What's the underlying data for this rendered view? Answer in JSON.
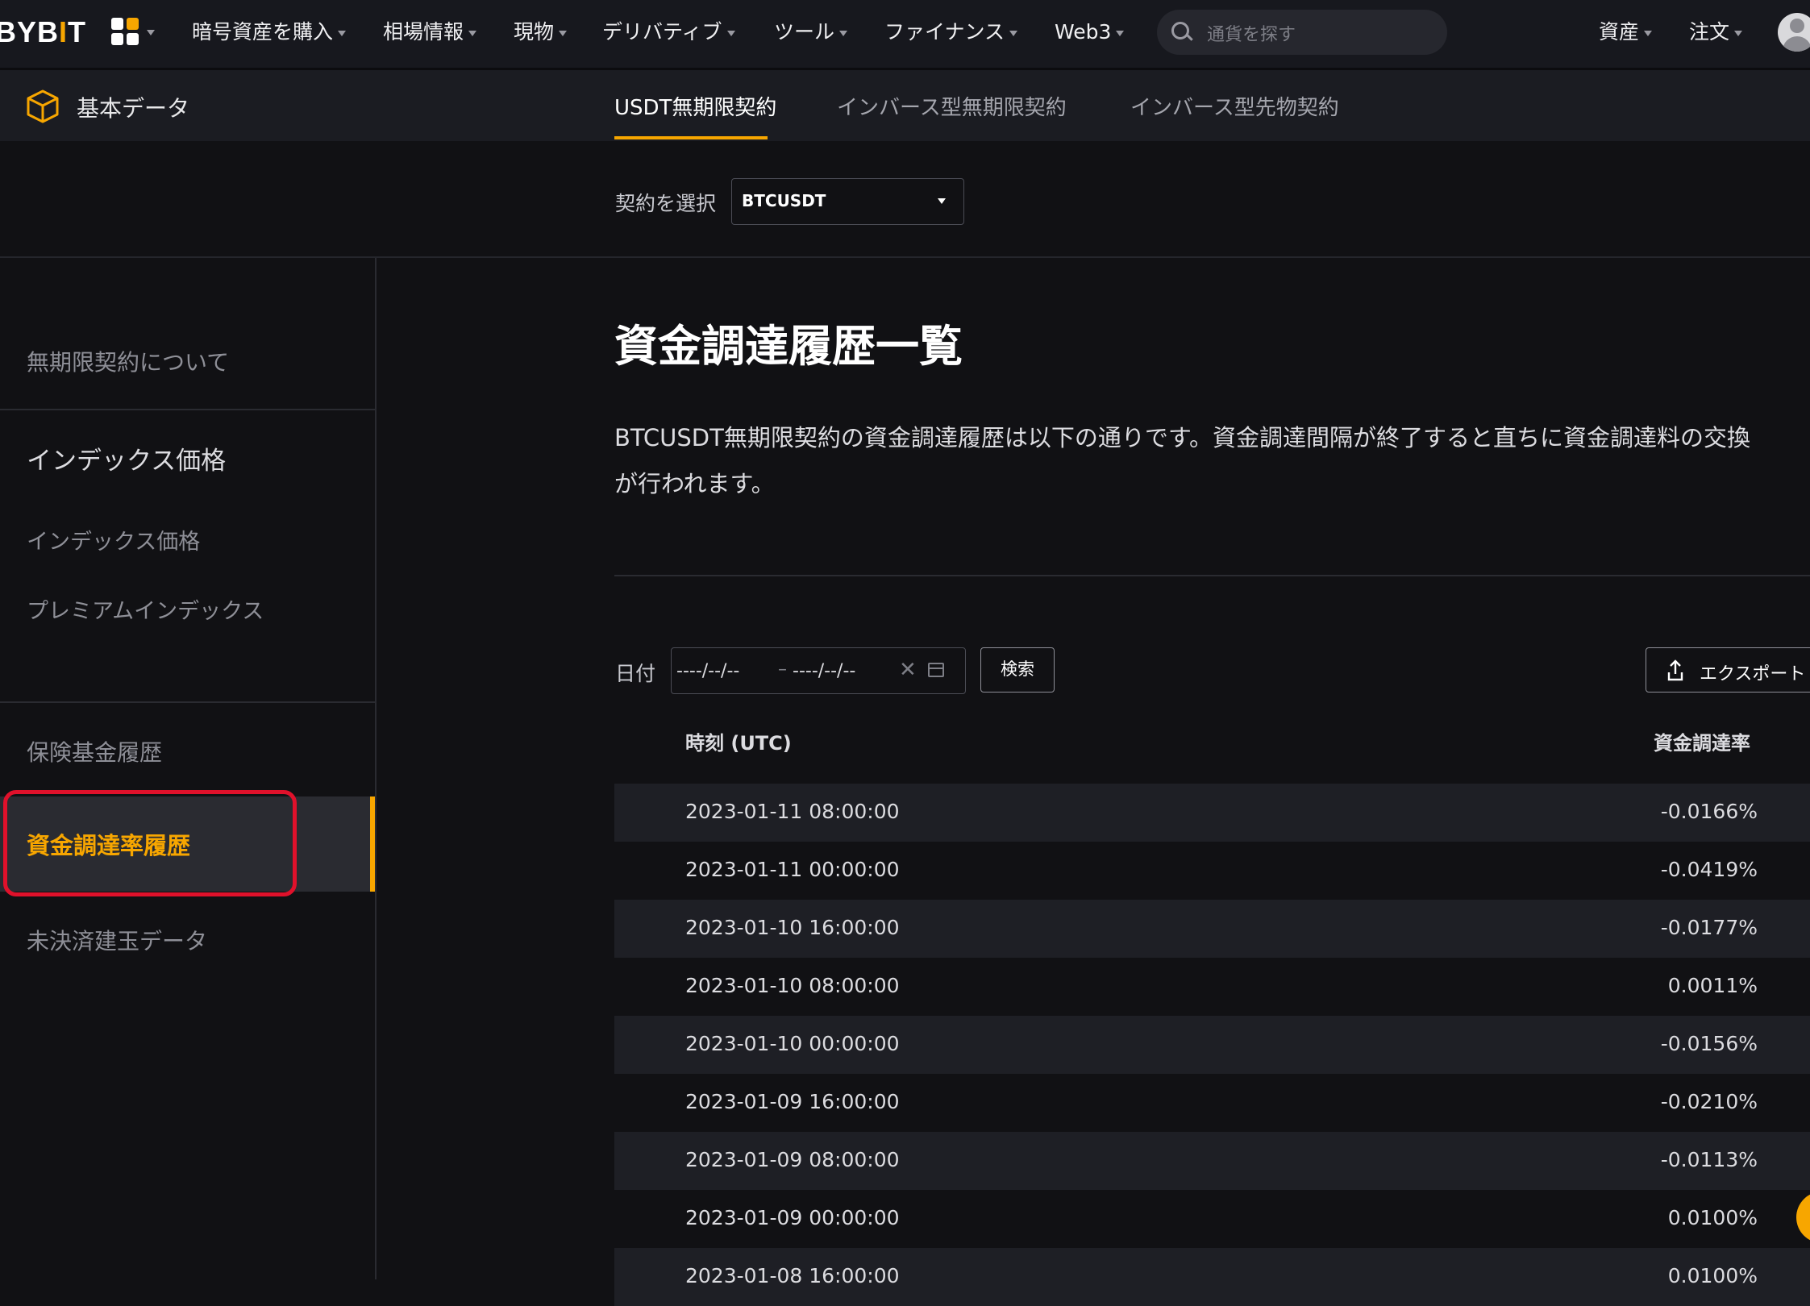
{
  "brand": {
    "logo_text_a": "BYB",
    "logo_text_b": "I",
    "logo_text_c": "T"
  },
  "topnav": {
    "items": [
      "暗号資産を購入",
      "相場情報",
      "現物",
      "デリバティブ",
      "ツール",
      "ファイナンス",
      "Web3"
    ],
    "search_placeholder": "通貨を探す",
    "right_items": [
      "資産",
      "注文"
    ]
  },
  "subnav": {
    "title": "基本データ",
    "tabs": [
      "USDT無期限契約",
      "インバース型無期限契約",
      "インバース型先物契約"
    ],
    "active_tab": 0
  },
  "contract_select": {
    "label": "契約を選択",
    "value": "BTCUSDT"
  },
  "sidebar": {
    "about": "無期限契約について",
    "index_heading": "インデックス価格",
    "index_items": [
      "インデックス価格",
      "プレミアムインデックス"
    ],
    "insurance": "保険基金履歴",
    "funding": "資金調達率履歴",
    "open_interest": "未決済建玉データ"
  },
  "main": {
    "title": "資金調達履歴一覧",
    "desc_line1": "BTCUSDT無期限契約の資金調達履歴は以下の通りです。資金調達間隔が終了すると直ちに資金調達料の交換",
    "desc_line2": "が行われます。"
  },
  "filters": {
    "date_label": "日付",
    "date_from": "----/--/--",
    "date_to": "----/--/--",
    "search_button": "検索",
    "export_button": "エクスポート"
  },
  "table": {
    "headers": {
      "time": "時刻 (UTC)",
      "rate": "資金調達率"
    },
    "rows": [
      {
        "time": "2023-01-11 08:00:00",
        "rate": "-0.0166%"
      },
      {
        "time": "2023-01-11 00:00:00",
        "rate": "-0.0419%"
      },
      {
        "time": "2023-01-10 16:00:00",
        "rate": "-0.0177%"
      },
      {
        "time": "2023-01-10 08:00:00",
        "rate": "0.0011%"
      },
      {
        "time": "2023-01-10 00:00:00",
        "rate": "-0.0156%"
      },
      {
        "time": "2023-01-09 16:00:00",
        "rate": "-0.0210%"
      },
      {
        "time": "2023-01-09 08:00:00",
        "rate": "-0.0113%"
      },
      {
        "time": "2023-01-09 00:00:00",
        "rate": "0.0100%"
      },
      {
        "time": "2023-01-08 16:00:00",
        "rate": "0.0100%"
      }
    ]
  },
  "colors": {
    "accent": "#f7a600",
    "background": "#111114",
    "highlight": "#e0112b"
  }
}
